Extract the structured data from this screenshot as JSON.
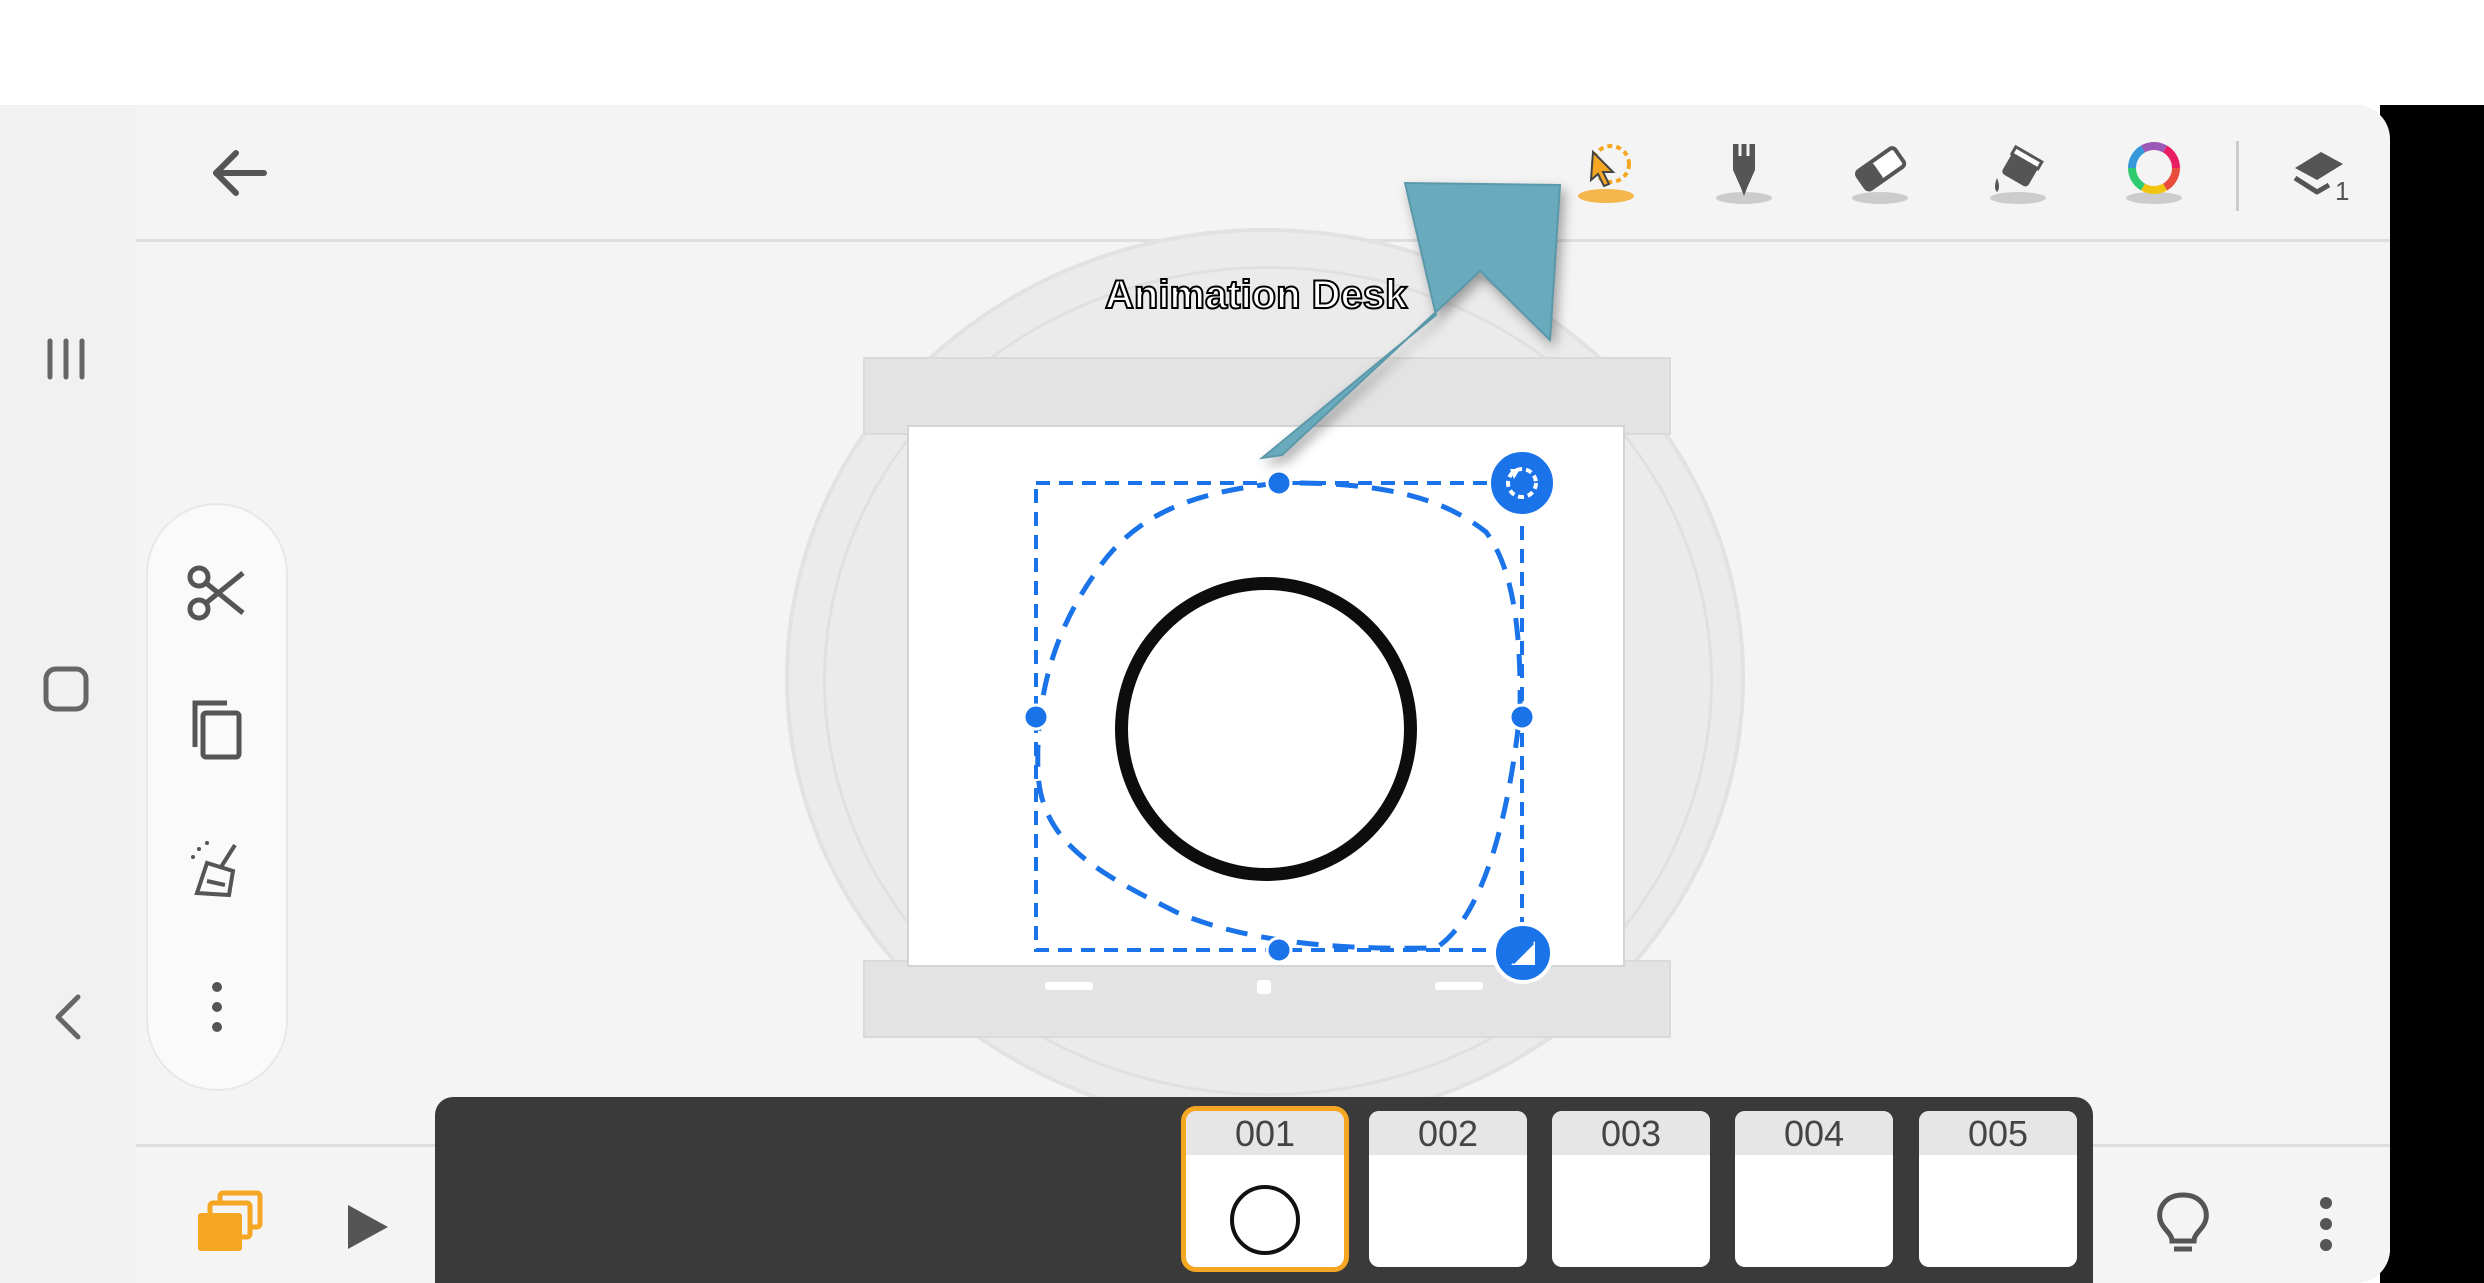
{
  "app": {
    "watermark": "Animation Desk"
  },
  "toolbar": {
    "items": [
      {
        "name": "lasso-select",
        "selected": true
      },
      {
        "name": "pen"
      },
      {
        "name": "eraser"
      },
      {
        "name": "fill-bucket"
      },
      {
        "name": "color-wheel"
      },
      {
        "name": "layers",
        "badge": "1"
      }
    ]
  },
  "side_tools": [
    "cut",
    "copy",
    "clear",
    "more"
  ],
  "timeline": {
    "frames": [
      {
        "label": "001",
        "selected": true
      },
      {
        "label": "002"
      },
      {
        "label": "003"
      },
      {
        "label": "004"
      },
      {
        "label": "005"
      }
    ]
  },
  "colors": {
    "accent": "#f5a623",
    "selection": "#1a73e8",
    "arrow": "#6aaabd"
  }
}
